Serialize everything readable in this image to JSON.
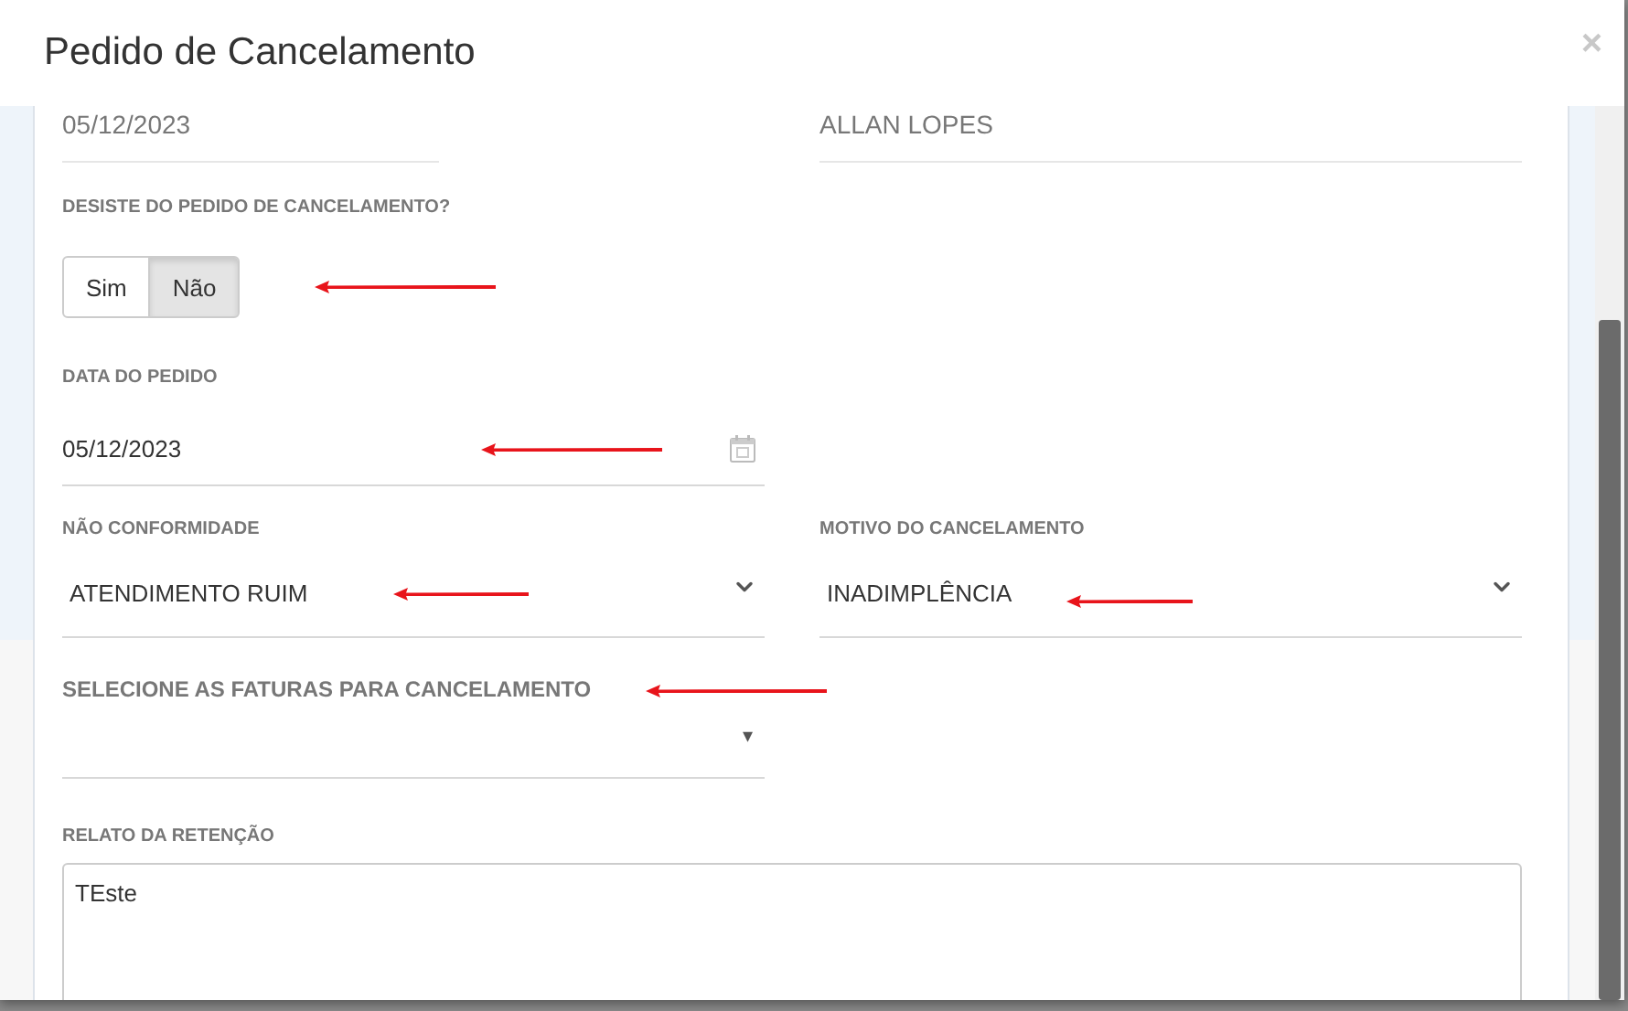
{
  "modal": {
    "title": "Pedido de Cancelamento",
    "close": "×"
  },
  "summary": [
    {
      "value": "05/12/2023"
    },
    {
      "value": "ALLAN LOPES"
    }
  ],
  "toggle": {
    "label": "DESISTE DO PEDIDO DE CANCELAMENTO?",
    "options": [
      {
        "label": "Sim",
        "selected": false
      },
      {
        "label": "Não",
        "selected": true
      }
    ]
  },
  "date_field": {
    "label": "DATA DO PEDIDO",
    "value": "05/12/2023"
  },
  "selects": [
    {
      "label": "NÃO CONFORMIDADE",
      "value": "ATENDIMENTO RUIM"
    },
    {
      "label": "MOTIVO DO CANCELAMENTO",
      "value": "INADIMPLÊNCIA"
    }
  ],
  "invoices": {
    "heading": "SELECIONE AS FATURAS PARA CANCELAMENTO",
    "caret": "▾"
  },
  "report": {
    "label": "RELATO DA RETENÇÃO",
    "value": "TEste"
  }
}
